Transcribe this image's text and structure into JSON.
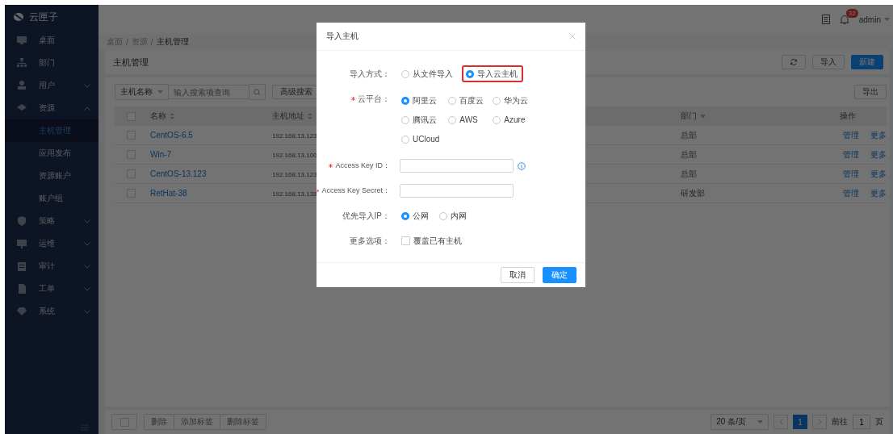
{
  "sidebar": {
    "logo": "云匣子",
    "items": [
      {
        "label": "桌面"
      },
      {
        "label": "部门"
      },
      {
        "label": "用户",
        "expanded": false
      },
      {
        "label": "资源",
        "expanded": true,
        "children": [
          {
            "label": "主机管理",
            "selected": true
          },
          {
            "label": "应用发布",
            "selected": false
          },
          {
            "label": "资源账户",
            "selected": false
          },
          {
            "label": "账户组",
            "selected": false
          }
        ]
      },
      {
        "label": "策略",
        "expanded": false
      },
      {
        "label": "运维",
        "expanded": false
      },
      {
        "label": "审计",
        "expanded": false
      },
      {
        "label": "工单",
        "expanded": false
      },
      {
        "label": "系统",
        "expanded": false
      }
    ]
  },
  "header": {
    "notifications": "32",
    "user": "admin"
  },
  "breadcrumb": {
    "separator": "/",
    "items": [
      "桌面",
      "资源",
      "主机管理"
    ]
  },
  "page": {
    "title": "主机管理",
    "buttons": [
      {
        "label": "导入",
        "kind": "default"
      },
      {
        "label": "新建",
        "kind": "primary"
      }
    ]
  },
  "search": {
    "field": "主机名称",
    "placeholder": "输入搜索项查询",
    "advanced": "高级搜索",
    "export": "导出"
  },
  "table": {
    "all_checked": false,
    "columns": [
      {
        "label": "名称",
        "kind": "sort"
      },
      {
        "label": "主机地址",
        "kind": "sort"
      },
      {
        "label": "部门",
        "kind": "filter"
      },
      {
        "label": "操作",
        "kind": "plain"
      }
    ],
    "rows": [
      {
        "checked": false,
        "name": "CentOS-6.5",
        "address": "192.168.13.123",
        "department": "总部",
        "actions": [
          "管理",
          "更多"
        ]
      },
      {
        "checked": false,
        "name": "Win-7",
        "address": "192.168.13.100",
        "department": "总部",
        "actions": [
          "管理",
          "更多"
        ]
      },
      {
        "checked": false,
        "name": "CentOS-13.123",
        "address": "192.168.13.123",
        "department": "总部",
        "actions": [
          "管理",
          "更多"
        ]
      },
      {
        "checked": false,
        "name": "RetHat-38",
        "address": "192.168.13.138",
        "department": "研发部",
        "actions": [
          "管理",
          "更多"
        ]
      }
    ]
  },
  "bulk_actions": [
    "删除",
    "添加标签",
    "删除标签"
  ],
  "pagination": {
    "page_size": "20 条/页",
    "pages": [
      {
        "label": "1",
        "selected": true
      }
    ],
    "goto_label": "前往",
    "goto_value": "1",
    "goto_suffix": "页"
  },
  "modal": {
    "title": "导入主机",
    "fields": [
      {
        "kind": "radio",
        "label": "导入方式：",
        "required": false,
        "options": [
          {
            "label": "从文件导入",
            "selected": false,
            "highlighted": false
          },
          {
            "label": "导入云主机",
            "selected": true,
            "highlighted": true
          }
        ]
      },
      {
        "kind": "radio-grid",
        "label": "云平台：",
        "required": true,
        "options": [
          {
            "label": "阿里云",
            "selected": true,
            "highlighted": false
          },
          {
            "label": "百度云",
            "selected": false,
            "highlighted": false
          },
          {
            "label": "华为云",
            "selected": false,
            "highlighted": false
          },
          {
            "label": "腾讯云",
            "selected": false,
            "highlighted": false
          },
          {
            "label": "AWS",
            "selected": false,
            "highlighted": false
          },
          {
            "label": "Azure",
            "selected": false,
            "highlighted": false
          },
          {
            "label": "UCloud",
            "selected": false,
            "highlighted": false
          }
        ]
      },
      {
        "kind": "input",
        "label": "Access Key ID：",
        "required": true,
        "info": true
      },
      {
        "kind": "input",
        "label": "Access Key Secret：",
        "required": true,
        "info": false
      },
      {
        "kind": "radio",
        "label": "优先导入IP：",
        "required": false,
        "options": [
          {
            "label": "公网",
            "selected": true,
            "highlighted": false
          },
          {
            "label": "内网",
            "selected": false,
            "highlighted": false
          }
        ]
      },
      {
        "kind": "checkbox",
        "label": "更多选项：",
        "required": false,
        "options": [
          {
            "label": "覆盖已有主机",
            "checked": false
          }
        ]
      }
    ],
    "buttons": [
      {
        "label": "取消",
        "kind": "default"
      },
      {
        "label": "确定",
        "kind": "primary"
      }
    ]
  }
}
